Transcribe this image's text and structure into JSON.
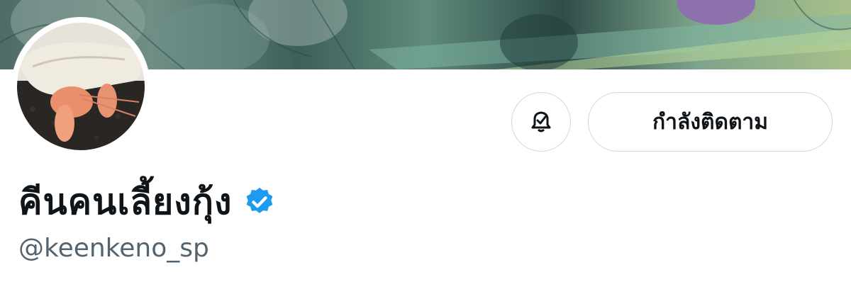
{
  "profile": {
    "display_name": "คีนคนเลี้ยงกุ้ง",
    "handle": "@keenkeno_sp",
    "verified_icon": "verified-badge-icon",
    "avatar_subject": "hermit-crab"
  },
  "actions": {
    "notify_icon": "bell-check-icon",
    "follow_label": "กำลังติดตาม"
  },
  "colors": {
    "verified": "#1d9bf0",
    "text": "#0f1419",
    "secondary_text": "#536471",
    "button_border": "#cfd9de"
  }
}
